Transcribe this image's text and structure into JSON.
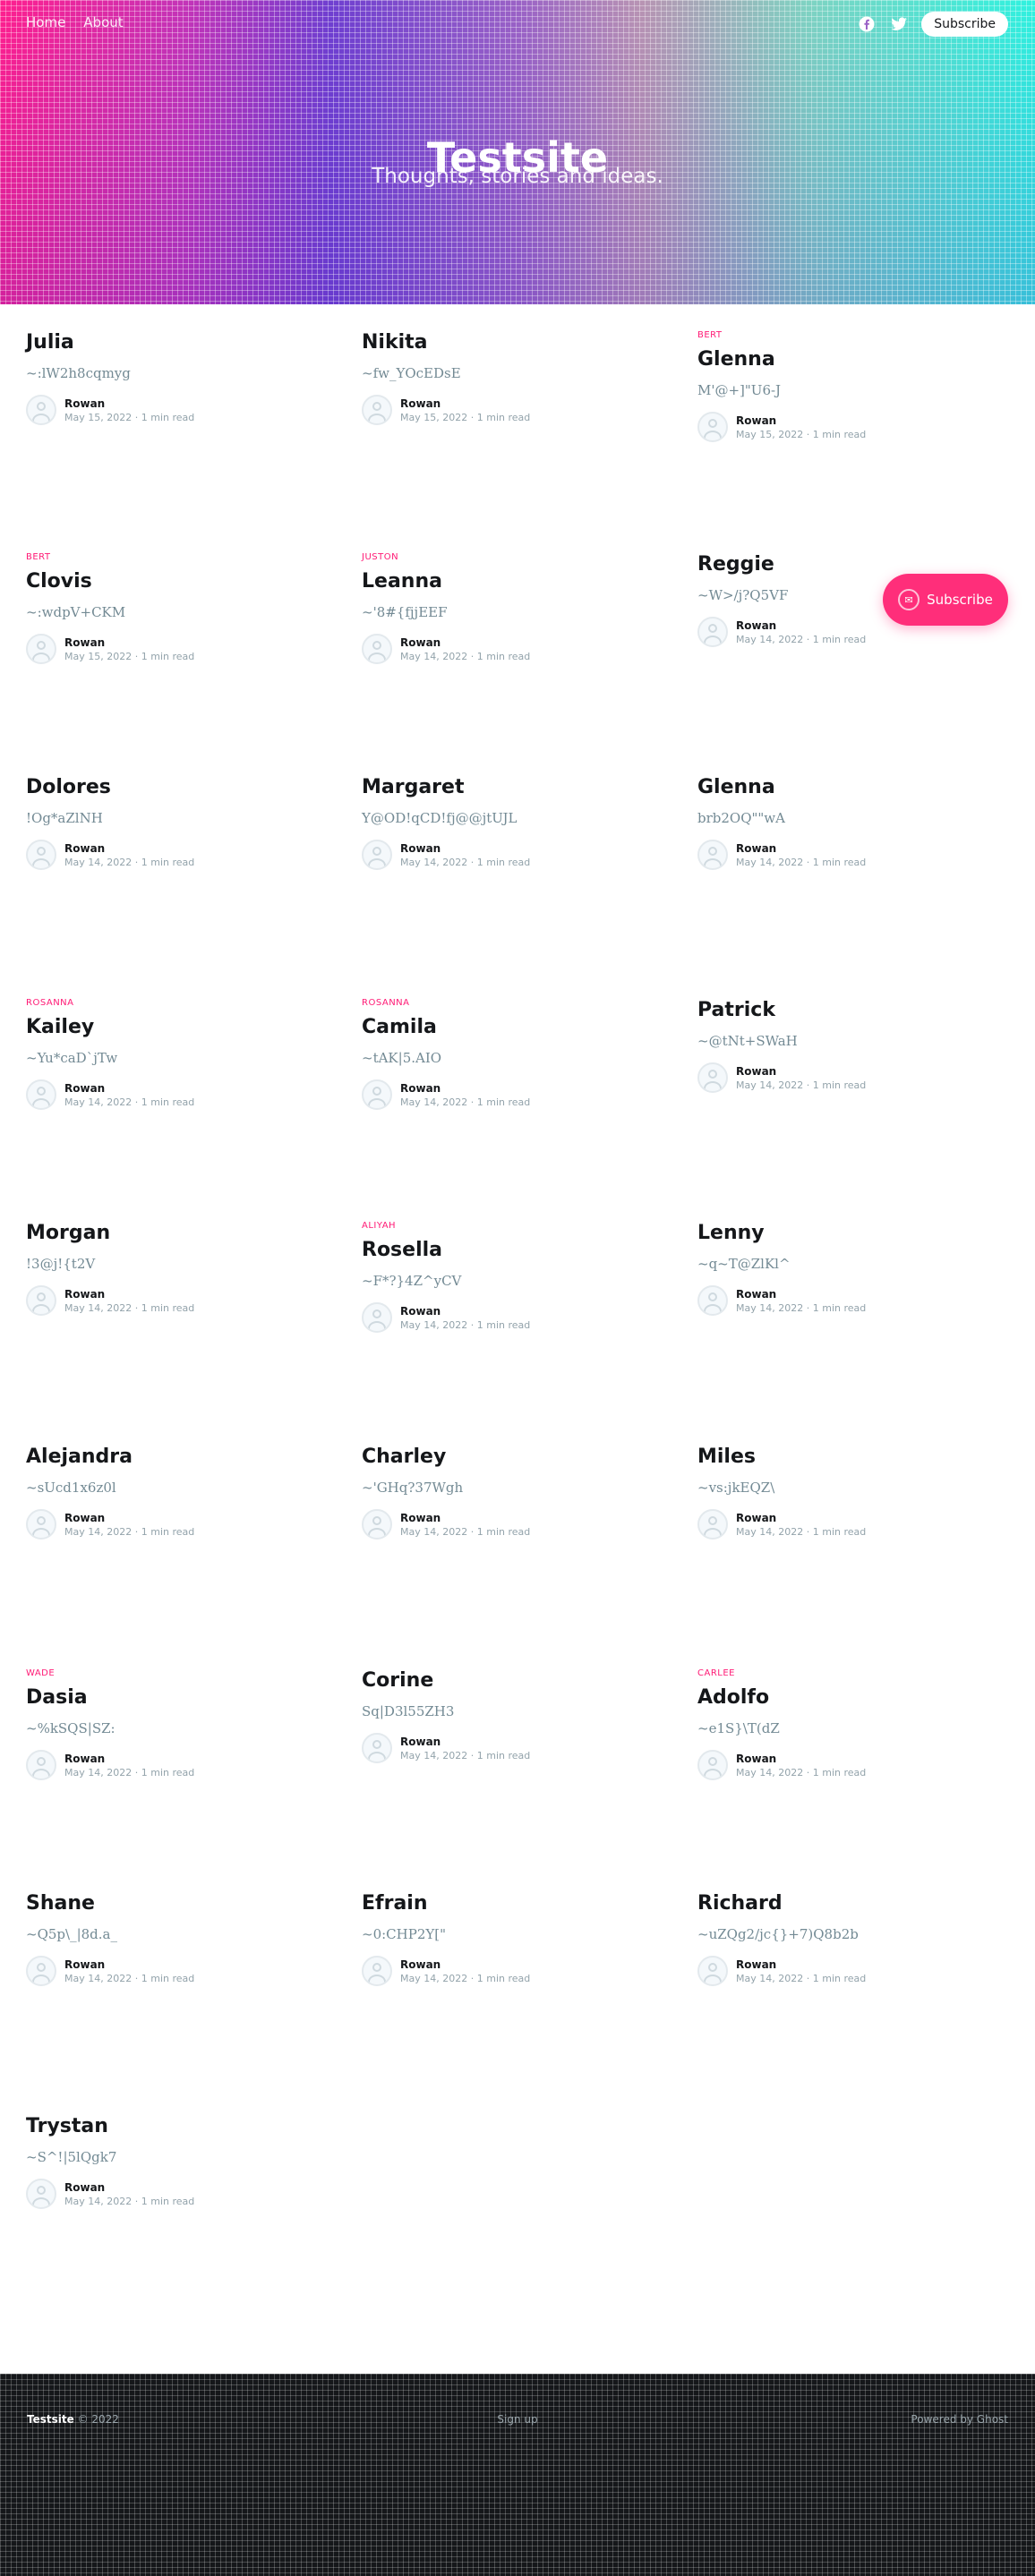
{
  "nav": {
    "links": [
      "Home",
      "About"
    ],
    "subscribe_label": "Subscribe",
    "social_icons": [
      "facebook-icon",
      "twitter-icon"
    ]
  },
  "hero": {
    "title": "Testsite",
    "description": "Thoughts, stories and ideas."
  },
  "posts": [
    {
      "tag": "",
      "title": "Julia",
      "excerpt": "~:lW2h8cqmyg",
      "author": "Rowan",
      "date": "May 15, 2022",
      "read": "1 min read"
    },
    {
      "tag": "",
      "title": "Nikita",
      "excerpt": "~fw_YOcEDsE",
      "author": "Rowan",
      "date": "May 15, 2022",
      "read": "1 min read"
    },
    {
      "tag": "BERT",
      "title": "Glenna",
      "excerpt": "M'@+]\"U6-J",
      "author": "Rowan",
      "date": "May 15, 2022",
      "read": "1 min read"
    },
    {
      "tag": "BERT",
      "title": "Clovis",
      "excerpt": "~:wdpV+CKM",
      "author": "Rowan",
      "date": "May 15, 2022",
      "read": "1 min read"
    },
    {
      "tag": "JUSTON",
      "title": "Leanna",
      "excerpt": "~'8#{fjjEEF",
      "author": "Rowan",
      "date": "May 14, 2022",
      "read": "1 min read"
    },
    {
      "tag": "",
      "title": "Reggie",
      "excerpt": "~W>/j?Q5VF",
      "author": "Rowan",
      "date": "May 14, 2022",
      "read": "1 min read"
    },
    {
      "tag": "",
      "title": "Dolores",
      "excerpt": "!Og*aZlNH",
      "author": "Rowan",
      "date": "May 14, 2022",
      "read": "1 min read"
    },
    {
      "tag": "",
      "title": "Margaret",
      "excerpt": "Y@OD!qCD!fj@@jtUJL",
      "author": "Rowan",
      "date": "May 14, 2022",
      "read": "1 min read"
    },
    {
      "tag": "",
      "title": "Glenna",
      "excerpt": "brb2OQ\"\"wA",
      "author": "Rowan",
      "date": "May 14, 2022",
      "read": "1 min read"
    },
    {
      "tag": "ROSANNA",
      "title": "Kailey",
      "excerpt": "~Yu*caD`jTw",
      "author": "Rowan",
      "date": "May 14, 2022",
      "read": "1 min read"
    },
    {
      "tag": "ROSANNA",
      "title": "Camila",
      "excerpt": "~tAK|5.AIO",
      "author": "Rowan",
      "date": "May 14, 2022",
      "read": "1 min read"
    },
    {
      "tag": "",
      "title": "Patrick",
      "excerpt": "~@tNt+SWaH",
      "author": "Rowan",
      "date": "May 14, 2022",
      "read": "1 min read"
    },
    {
      "tag": "",
      "title": "Morgan",
      "excerpt": "!3@j!{t2V",
      "author": "Rowan",
      "date": "May 14, 2022",
      "read": "1 min read"
    },
    {
      "tag": "ALIYAH",
      "title": "Rosella",
      "excerpt": "~F*?}4Z^yCV",
      "author": "Rowan",
      "date": "May 14, 2022",
      "read": "1 min read"
    },
    {
      "tag": "",
      "title": "Lenny",
      "excerpt": "~q~T@ZlKl^",
      "author": "Rowan",
      "date": "May 14, 2022",
      "read": "1 min read"
    },
    {
      "tag": "",
      "title": "Alejandra",
      "excerpt": "~sUcd1x6z0l",
      "author": "Rowan",
      "date": "May 14, 2022",
      "read": "1 min read"
    },
    {
      "tag": "",
      "title": "Charley",
      "excerpt": "~'GHq?37Wgh",
      "author": "Rowan",
      "date": "May 14, 2022",
      "read": "1 min read"
    },
    {
      "tag": "",
      "title": "Miles",
      "excerpt": "~vs:jkEQZ\\",
      "author": "Rowan",
      "date": "May 14, 2022",
      "read": "1 min read"
    },
    {
      "tag": "WADE",
      "title": "Dasia",
      "excerpt": "~%kSQS|SZ:",
      "author": "Rowan",
      "date": "May 14, 2022",
      "read": "1 min read"
    },
    {
      "tag": "",
      "title": "Corine",
      "excerpt": "Sq|D3l55ZH3",
      "author": "Rowan",
      "date": "May 14, 2022",
      "read": "1 min read"
    },
    {
      "tag": "CARLEE",
      "title": "Adolfo",
      "excerpt": "~e1S}\\T(dZ",
      "author": "Rowan",
      "date": "May 14, 2022",
      "read": "1 min read"
    },
    {
      "tag": "",
      "title": "Shane",
      "excerpt": "~Q5p\\_|8d.a_",
      "author": "Rowan",
      "date": "May 14, 2022",
      "read": "1 min read"
    },
    {
      "tag": "",
      "title": "Efrain",
      "excerpt": "~0:CHP2Y[\"",
      "author": "Rowan",
      "date": "May 14, 2022",
      "read": "1 min read"
    },
    {
      "tag": "",
      "title": "Richard",
      "excerpt": "~uZQg2/jc{}+7)Q8b2b",
      "author": "Rowan",
      "date": "May 14, 2022",
      "read": "1 min read"
    },
    {
      "tag": "",
      "title": "Trystan",
      "excerpt": "~S^!|5lQgk7",
      "author": "Rowan",
      "date": "May 14, 2022",
      "read": "1 min read"
    }
  ],
  "floating": {
    "subscribe_label": "Subscribe"
  },
  "footer": {
    "site": "Testsite",
    "copyright": "© 2022",
    "mid": "Sign up",
    "powered": "Powered by Ghost"
  }
}
